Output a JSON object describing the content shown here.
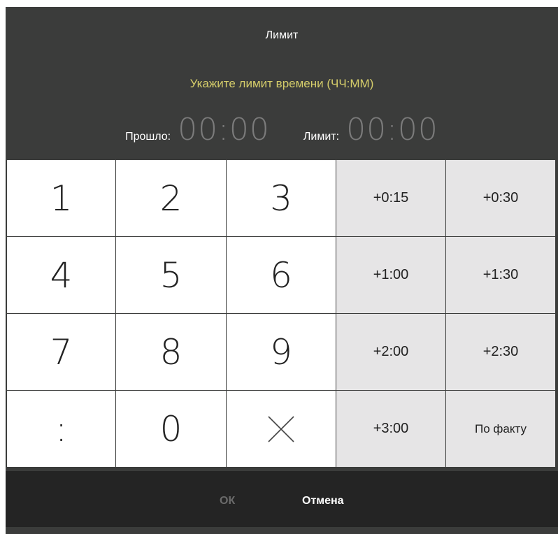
{
  "dialog": {
    "title": "Лимит",
    "prompt": "Укажите лимит времени (ЧЧ:ММ)",
    "elapsed_label": "Прошло:",
    "elapsed_value": "00:00",
    "limit_label": "Лимит:",
    "limit_value": "00:00"
  },
  "keypad": {
    "digits": [
      "1",
      "2",
      "3",
      "4",
      "5",
      "6",
      "7",
      "8",
      "9",
      ":",
      "0"
    ],
    "clear_icon": "close-icon",
    "increments": [
      "+0:15",
      "+0:30",
      "+1:00",
      "+1:30",
      "+2:00",
      "+2:30",
      "+3:00"
    ],
    "actual_label": "По факту"
  },
  "footer": {
    "ok_label": "ОК",
    "cancel_label": "Отмена"
  },
  "colors": {
    "dialog_bg": "#3b3c3b",
    "footer_bg": "#242424",
    "prompt": "#d5cd6a",
    "time_value": "#7b7b7b",
    "increment_bg": "#e6e5e6",
    "ok_disabled": "#6b6b6b"
  }
}
